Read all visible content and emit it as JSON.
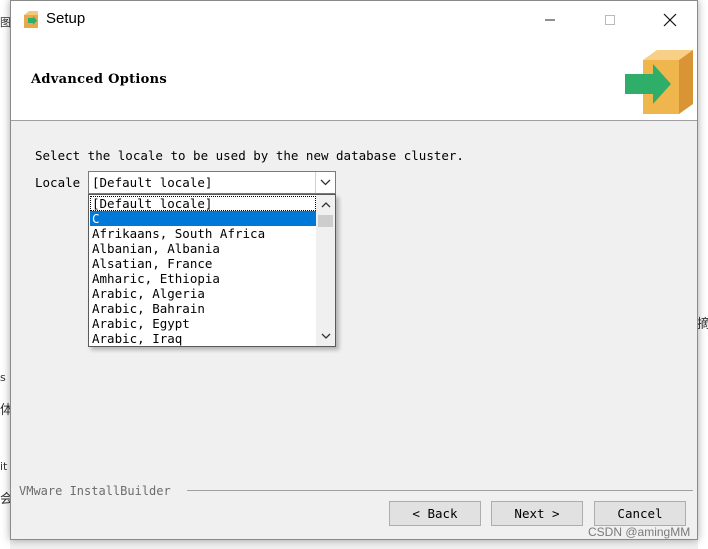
{
  "window": {
    "title": "Setup"
  },
  "header": {
    "title": "Advanced Options"
  },
  "main": {
    "instruction": "Select the locale to be used by the new database cluster.",
    "locale_label": "Locale",
    "locale_value": "[Default locale]",
    "dropdown_items": [
      "[Default locale]",
      "C",
      "Afrikaans, South Africa",
      "Albanian, Albania",
      "Alsatian, France",
      "Amharic, Ethiopia",
      "Arabic, Algeria",
      "Arabic, Bahrain",
      "Arabic, Egypt",
      "Arabic, Iraq"
    ],
    "selected_item": "C"
  },
  "footer": {
    "brand": "VMware InstallBuilder",
    "back_label": "< Back",
    "next_label": "Next >",
    "cancel_label": "Cancel"
  },
  "background": {
    "fragments": [
      "图",
      "s",
      "体",
      "it",
      "会",
      "摘"
    ]
  },
  "watermark": "CSDN @amingMM",
  "colors": {
    "selection": "#0078d7",
    "logo_box": "#f0b64e",
    "logo_arrow": "#2fae6a"
  },
  "icons": [
    "setup-app-icon",
    "minimize-icon",
    "maximize-icon",
    "close-icon",
    "installer-box-logo",
    "chevron-down-icon",
    "scroll-up-icon",
    "scroll-down-icon"
  ]
}
